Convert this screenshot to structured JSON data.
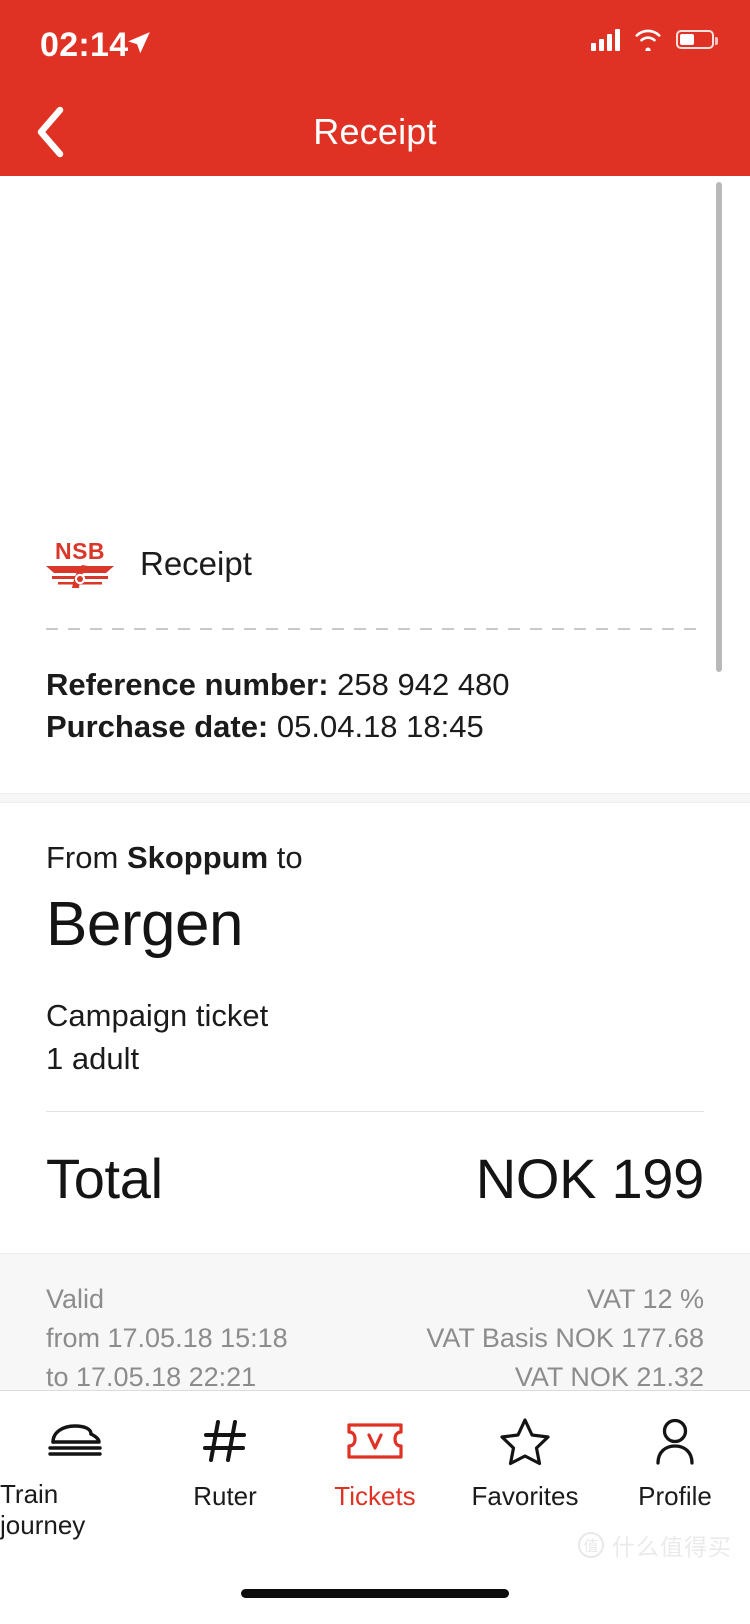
{
  "status_bar": {
    "time": "02:14",
    "location_icon": "location-arrow-icon",
    "signal_icon": "cellular-signal-icon",
    "wifi_icon": "wifi-icon",
    "battery_icon": "battery-icon"
  },
  "nav": {
    "back_icon": "chevron-left-icon",
    "title": "Receipt"
  },
  "receipt": {
    "brand": "NSB",
    "brand_mark_icon": "nsb-winged-wheel-icon",
    "title": "Receipt",
    "reference_label": "Reference number:",
    "reference_value": " 258 942 480",
    "purchase_label": "Purchase date:",
    "purchase_value": " 05.04.18 18:45"
  },
  "journey": {
    "from_prefix": "From ",
    "origin": "Skoppum",
    "to_suffix": " to",
    "destination": "Bergen",
    "ticket_type": "Campaign ticket",
    "passengers": "1 adult"
  },
  "total": {
    "label": "Total",
    "value": "NOK 199"
  },
  "validity": {
    "line1": "Valid",
    "line2": "from 17.05.18 15:18",
    "line3": "to 17.05.18 22:21"
  },
  "vat": {
    "line1": "VAT 12 %",
    "line2": "VAT Basis NOK 177.68",
    "line3": "VAT NOK 21.32"
  },
  "tabbar": {
    "items": [
      {
        "label": "Train journey",
        "icon": "train-icon",
        "active": false
      },
      {
        "label": "Ruter",
        "icon": "hash-icon",
        "active": false
      },
      {
        "label": "Tickets",
        "icon": "ticket-icon",
        "active": true
      },
      {
        "label": "Favorites",
        "icon": "star-icon",
        "active": false
      },
      {
        "label": "Profile",
        "icon": "person-icon",
        "active": false
      }
    ]
  },
  "watermark": {
    "badge": "值",
    "text": "什么值得买"
  },
  "colors": {
    "brand_red": "#E03224",
    "logo_red": "#D8372A",
    "text_primary": "#1b1b1b",
    "text_muted": "#8c8c8c",
    "band_bg": "#f7f7f7"
  }
}
